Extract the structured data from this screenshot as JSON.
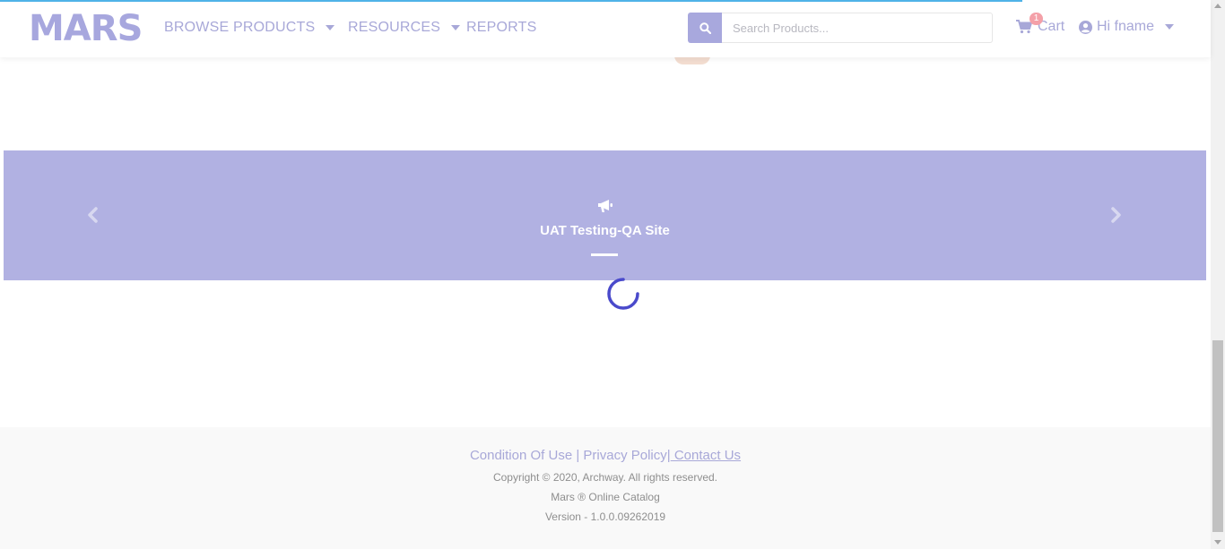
{
  "header": {
    "logo": "MARS",
    "nav": {
      "browse": "BROWSE PRODUCTS",
      "resources": "RESOURCES",
      "reports": "REPORTS"
    },
    "search": {
      "placeholder": "Search Products..."
    },
    "cart": {
      "label": "Cart",
      "count": "1"
    },
    "user": {
      "greeting": "Hi fname"
    }
  },
  "carousel": {
    "icon": "megaphone-icon",
    "title": "UAT Testing-QA Site"
  },
  "footer": {
    "links": {
      "condition": "Condition Of Use",
      "sep1": " | ",
      "privacy": "Privacy Policy",
      "sep2": "|",
      "contact": " Contact Us"
    },
    "copyright": "Copyright © 2020, Archway. All rights reserved.",
    "catalog": "Mars ® Online Catalog",
    "version": "Version - 1.0.0.09262019"
  },
  "colors": {
    "accent": "#a8a8dd",
    "carousel_bg": "#b1b1e2",
    "progress": "#4fb3e8",
    "spinner": "#4a4acb",
    "badge": "#f4a0a8"
  }
}
